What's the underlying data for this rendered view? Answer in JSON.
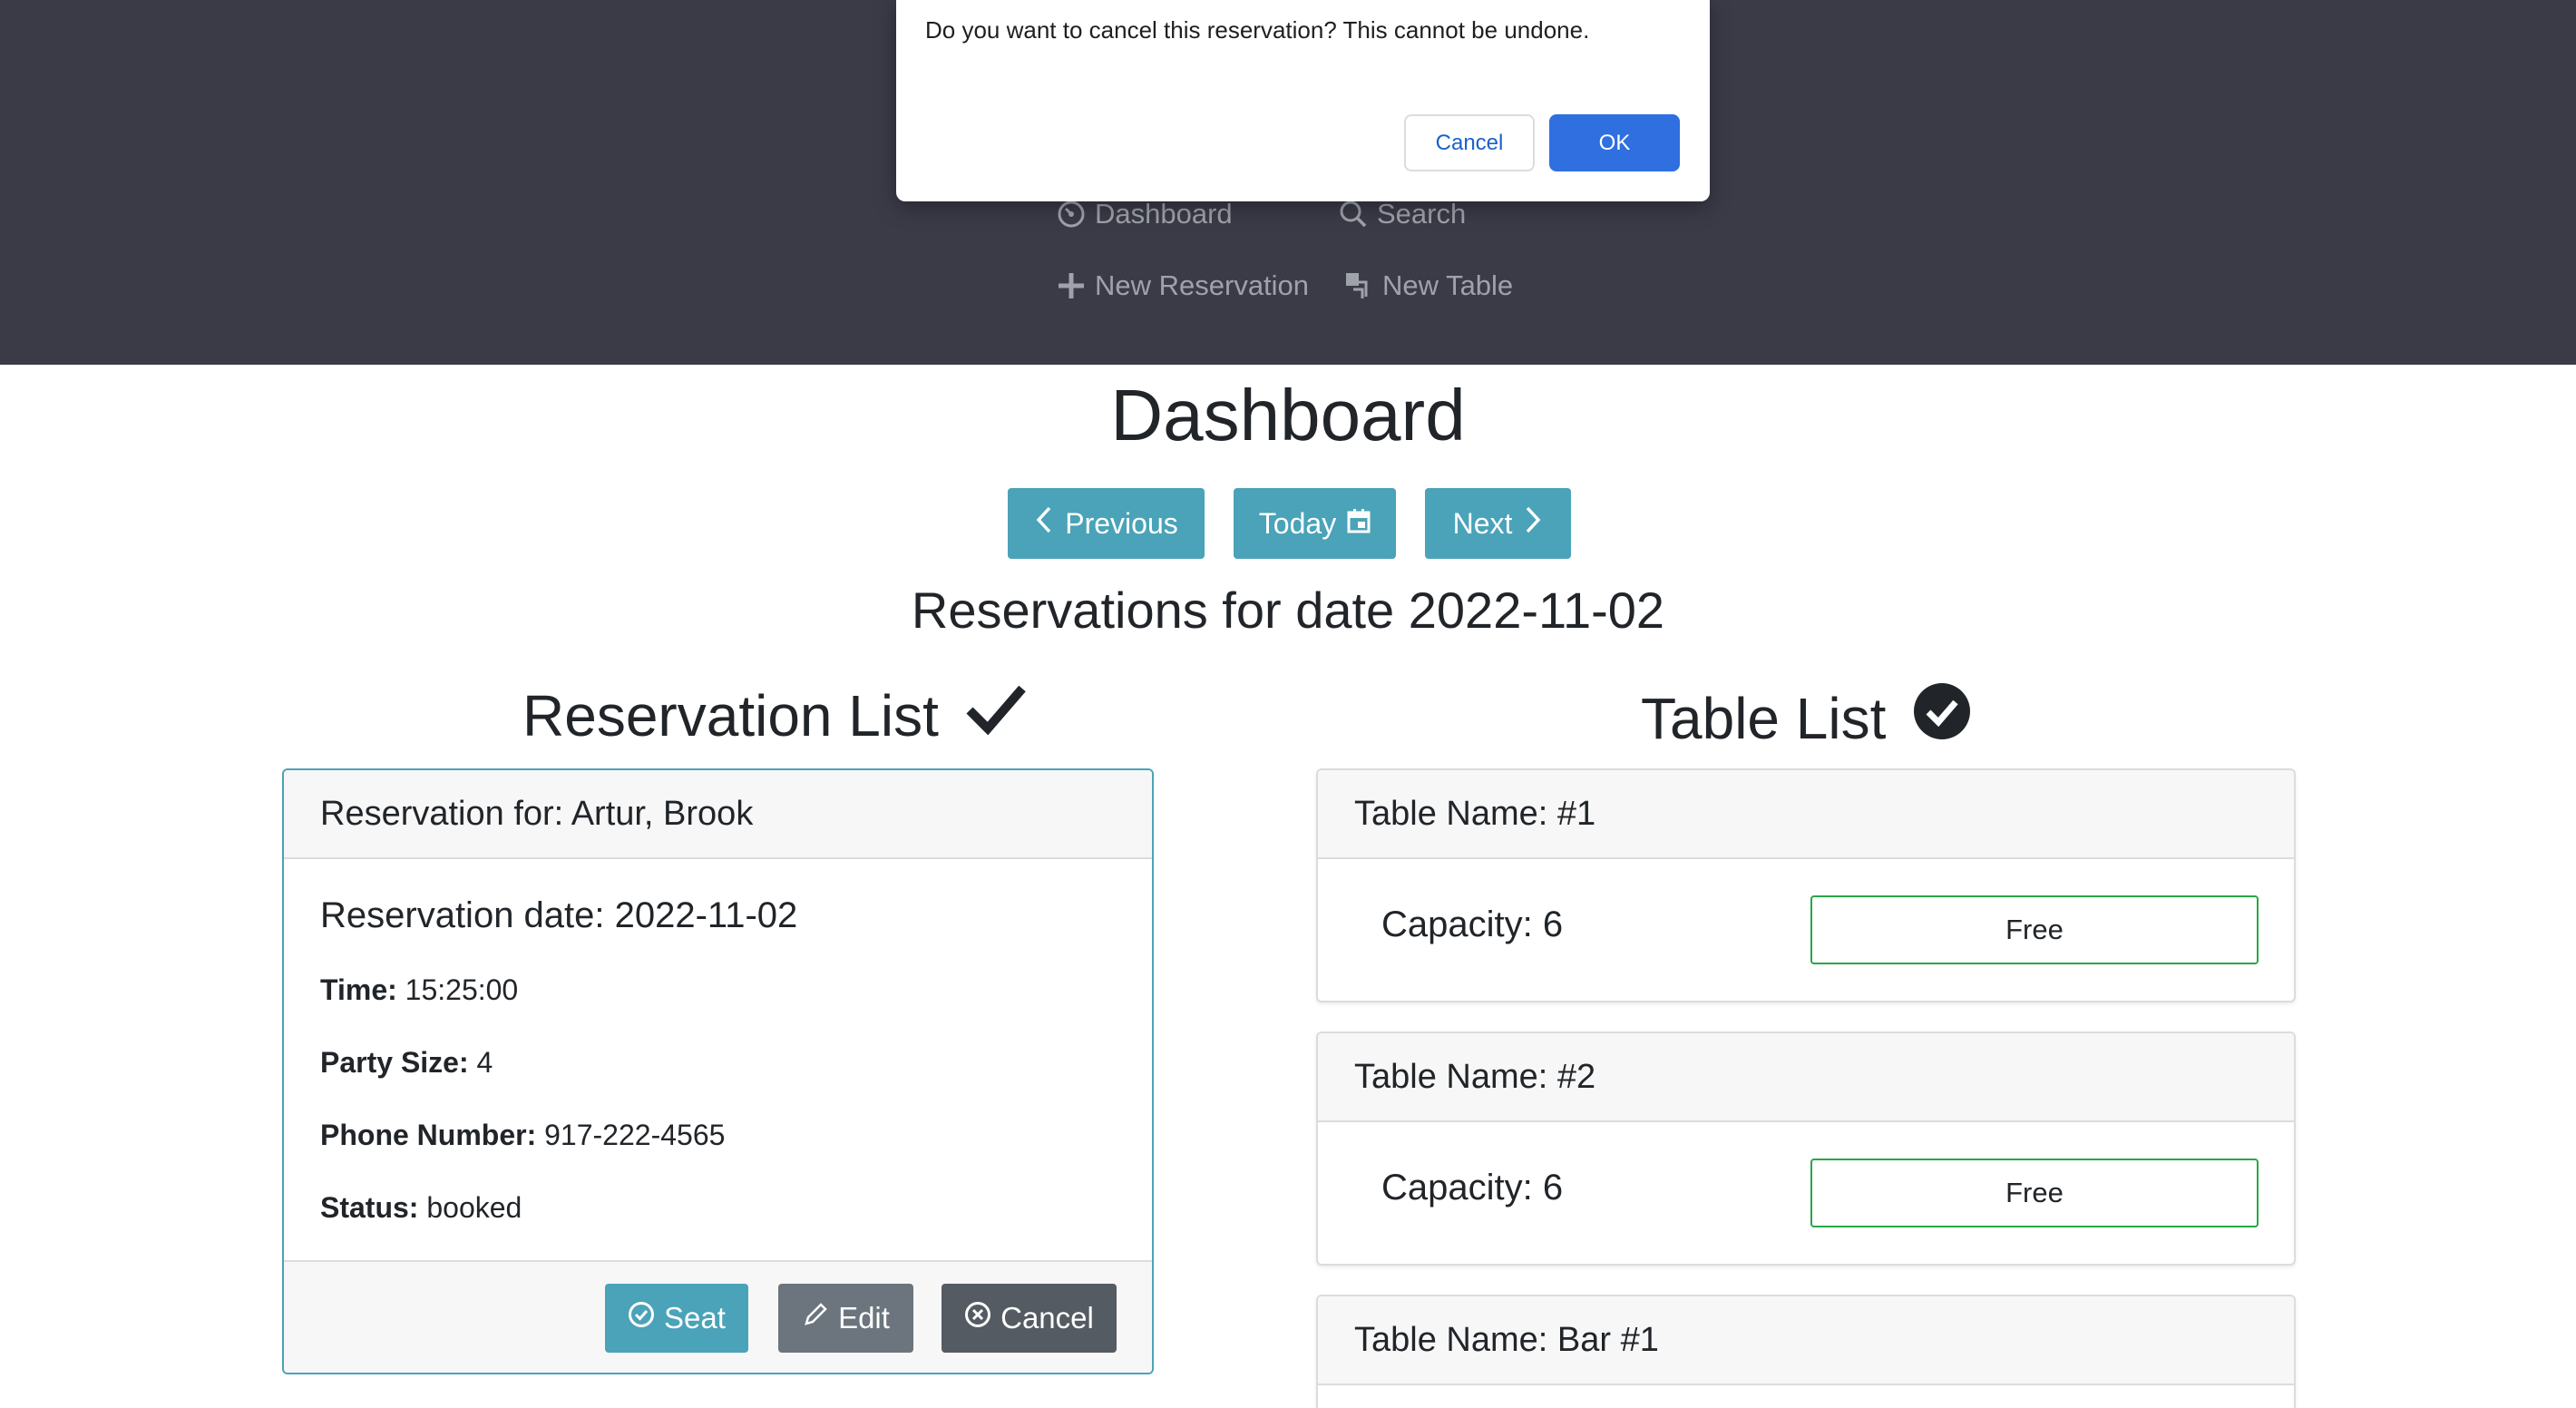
{
  "modal": {
    "message": "Do you want to cancel this reservation? This cannot be undone.",
    "cancel_label": "Cancel",
    "ok_label": "OK"
  },
  "nav": {
    "dashboard": "Dashboard",
    "search": "Search",
    "new_reservation": "New Reservation",
    "new_table": "New Table"
  },
  "page": {
    "title": "Dashboard",
    "previous_label": "Previous",
    "today_label": "Today",
    "next_label": "Next",
    "subtitle": "Reservations for date 2022-11-02"
  },
  "reservations": {
    "heading": "Reservation List",
    "items": [
      {
        "header": "Reservation for: Artur, Brook",
        "date_line": "Reservation date: 2022-11-02",
        "time_label": "Time:",
        "time_value": "15:25:00",
        "party_label": "Party Size:",
        "party_value": "4",
        "phone_label": "Phone Number:",
        "phone_value": "917-222-4565",
        "status_label": "Status:",
        "status_value": "booked",
        "seat_label": "Seat",
        "edit_label": "Edit",
        "cancel_label": "Cancel"
      }
    ]
  },
  "tables": {
    "heading": "Table List",
    "items": [
      {
        "name": "Table Name: #1",
        "capacity": "Capacity: 6",
        "status": "Free"
      },
      {
        "name": "Table Name: #2",
        "capacity": "Capacity: 6",
        "status": "Free"
      },
      {
        "name": "Table Name: Bar #1"
      }
    ]
  },
  "colors": {
    "topbar": "#3a3b47",
    "info": "#4aa3b8",
    "secondary": "#6c757d",
    "dark": "#545b62",
    "success_outline": "#28a745",
    "primary": "#2f6fe0"
  }
}
